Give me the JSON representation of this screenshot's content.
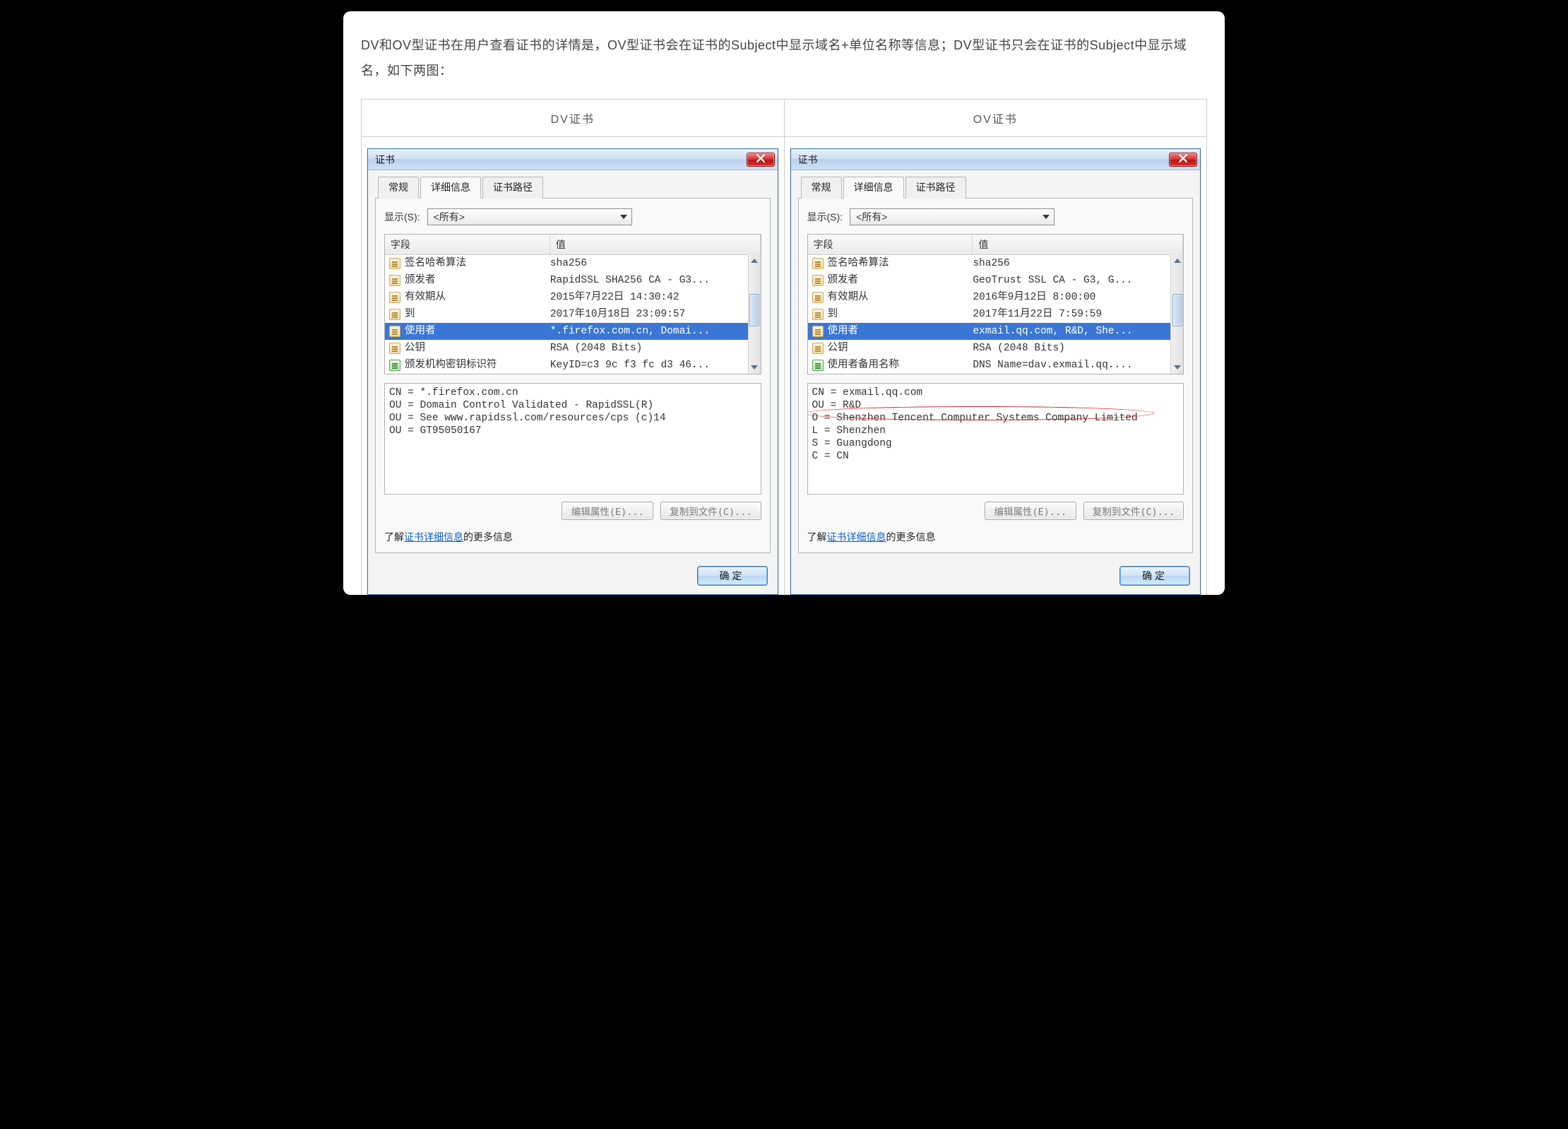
{
  "intro": "DV和OV型证书在用户查看证书的详情是，OV型证书会在证书的Subject中显示域名+单位名称等信息；DV型证书只会在证书的Subject中显示域名，如下两图：",
  "headers": {
    "dv": "DV证书",
    "ov": "OV证书"
  },
  "dlg": {
    "title": "证书",
    "tabs": {
      "general": "常规",
      "details": "详细信息",
      "path": "证书路径"
    },
    "show_label": "显示(S):",
    "show_value": "<所有>",
    "col_field": "字段",
    "col_value": "值",
    "btn_edit": "编辑属性(E)...",
    "btn_copy": "复制到文件(C)...",
    "link_pre": "了解",
    "link_text": "证书详细信息",
    "link_post": "的更多信息",
    "ok": "确定"
  },
  "dv": {
    "rows": [
      {
        "field": "签名哈希算法",
        "value": "sha256",
        "icon": "doc"
      },
      {
        "field": "颁发者",
        "value": "RapidSSL SHA256 CA - G3...",
        "icon": "doc"
      },
      {
        "field": "有效期从",
        "value": "2015年7月22日 14:30:42",
        "icon": "doc"
      },
      {
        "field": "到",
        "value": "2017年10月18日 23:09:57",
        "icon": "doc"
      },
      {
        "field": "使用者",
        "value": "*.firefox.com.cn, Domai...",
        "icon": "doc",
        "selected": true
      },
      {
        "field": "公钥",
        "value": "RSA (2048 Bits)",
        "icon": "doc"
      },
      {
        "field": "颁发机构密钥标识符",
        "value": "KeyID=c3 9c f3 fc d3 46...",
        "icon": "green"
      }
    ],
    "subject": "CN = *.firefox.com.cn\nOU = Domain Control Validated - RapidSSL(R)\nOU = See www.rapidssl.com/resources/cps (c)14\nOU = GT95050167"
  },
  "ov": {
    "rows": [
      {
        "field": "签名哈希算法",
        "value": "sha256",
        "icon": "doc"
      },
      {
        "field": "颁发者",
        "value": "GeoTrust SSL CA - G3, G...",
        "icon": "doc"
      },
      {
        "field": "有效期从",
        "value": "2016年9月12日 8:00:00",
        "icon": "doc"
      },
      {
        "field": "到",
        "value": "2017年11月22日 7:59:59",
        "icon": "doc"
      },
      {
        "field": "使用者",
        "value": "exmail.qq.com, R&D, She...",
        "icon": "doc",
        "selected": true
      },
      {
        "field": "公钥",
        "value": "RSA (2048 Bits)",
        "icon": "doc"
      },
      {
        "field": "使用者备用名称",
        "value": "DNS Name=dav.exmail.qq....",
        "icon": "green"
      }
    ],
    "subject": "CN = exmail.qq.com\nOU = R&D\nO = Shenzhen Tencent Computer Systems Company Limited\nL = Shenzhen\nS = Guangdong\nC = CN",
    "circle_o_line": true
  }
}
